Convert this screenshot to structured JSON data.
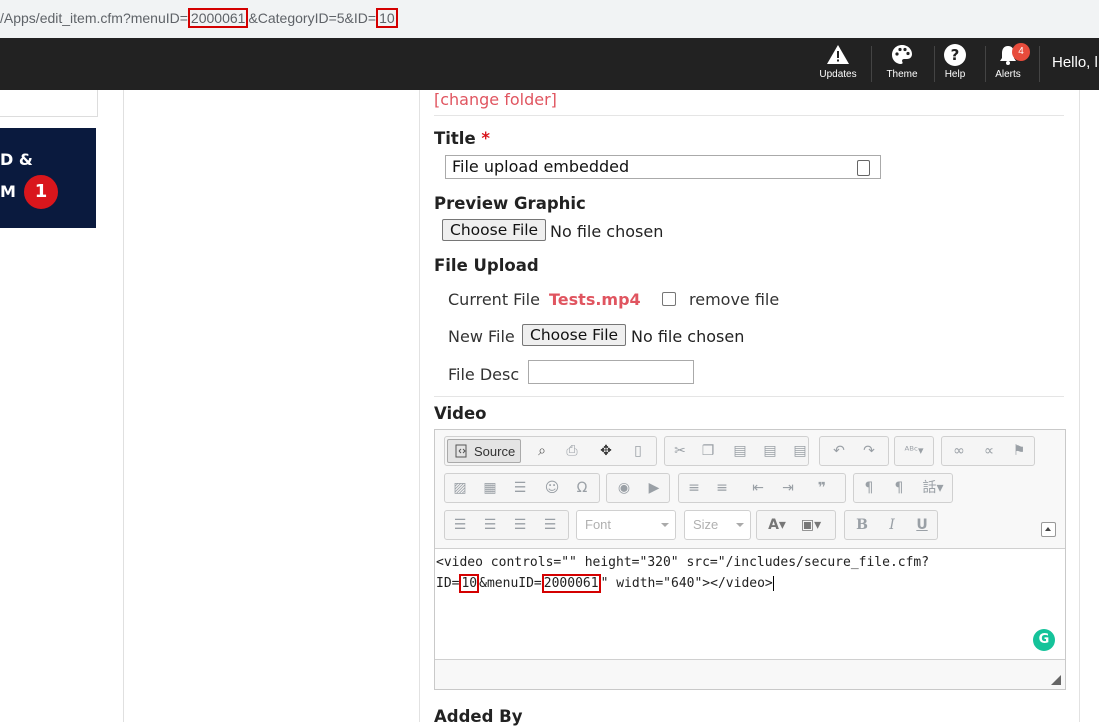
{
  "url": {
    "prefix": "/Apps/edit_item.cfm?menuID=",
    "menu_id": "2000061",
    "middle": "&CategoryID=5&ID=",
    "item_id": "10"
  },
  "nav": {
    "updates_label": "Updates",
    "theme_label": "Theme",
    "help_label": "Help",
    "alerts_label": "Alerts",
    "alerts_count": "4",
    "greeting": "Hello, l"
  },
  "promo": {
    "line1": "D &",
    "line2": "M",
    "badge": "1"
  },
  "form": {
    "change_folder": "[change folder]",
    "title_label": "Title",
    "required_mark": "*",
    "title_value": "File upload embedded",
    "preview_label": "Preview Graphic",
    "choose_file": "Choose File",
    "no_file": "No file chosen",
    "file_upload_label": "File Upload",
    "current_file_label": "Current File",
    "current_file_name": "Tests.mp4",
    "remove_file_label": "remove file",
    "new_file_label": "New File",
    "file_desc_label": "File Desc",
    "video_label": "Video",
    "added_by_label": "Added By"
  },
  "editor": {
    "source_label": "Source",
    "font_placeholder": "Font",
    "size_placeholder": "Size",
    "code_line1": "<video controls=\"\" height=\"320\" src=\"/includes/secure_file.cfm?",
    "code_line2_a": "ID=",
    "code_line2_id": "10",
    "code_line2_b": "&menuID=",
    "code_line2_menu": "2000061",
    "code_line2_c": "\" width=\"640\"></video>",
    "grammarly_glyph": "G"
  },
  "colors": {
    "nav_bg": "#222222",
    "accent_red": "#e05560",
    "highlight_box": "#d40000",
    "promo_bg": "#0a1a3e"
  }
}
